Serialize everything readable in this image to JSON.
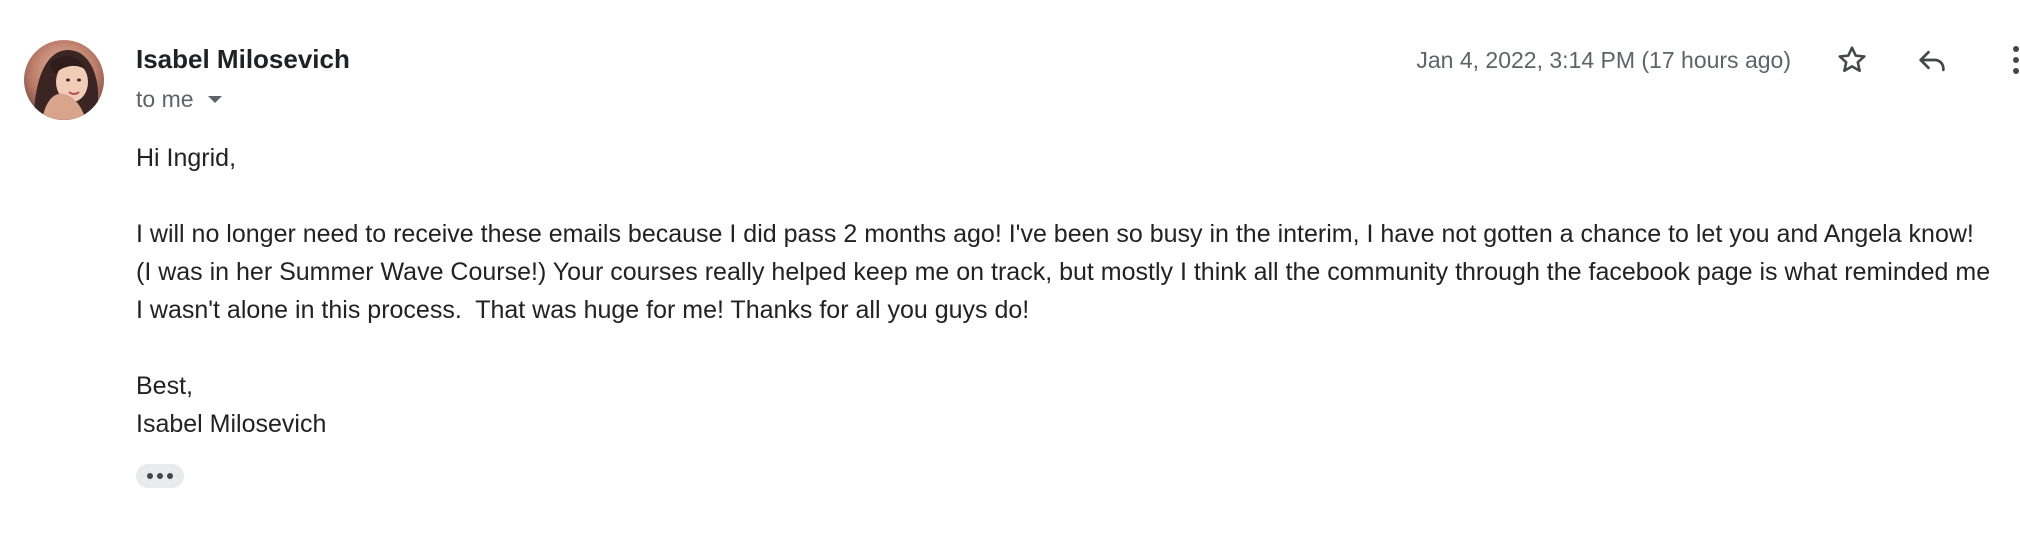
{
  "message": {
    "sender": {
      "name": "Isabel Milosevich"
    },
    "recipient_label": "to me",
    "timestamp": "Jan 4, 2022, 3:14 PM (17 hours ago)",
    "actions": {
      "star_icon": "star-outline-icon",
      "reply_icon": "reply-icon",
      "more_icon": "more-vert-icon"
    },
    "body": {
      "greeting": "Hi Ingrid,",
      "paragraph": "I will no longer need to receive these emails because I did pass 2 months ago! I've been so busy in the interim, I have not gotten a chance to let you and Angela know! (I was in her Summer Wave Course!) Your courses really helped keep me on track, but mostly I think all the community through the facebook page is what reminded me I wasn't alone in this process.  That was huge for me! Thanks for all you guys do!",
      "signoff": "Best,",
      "signature": "Isabel Milosevich"
    },
    "show_trimmed_icon": "ellipsis-icon"
  },
  "colors": {
    "primary_text": "#202124",
    "secondary_text": "#5f6368",
    "chip_background": "#e8eaed"
  }
}
